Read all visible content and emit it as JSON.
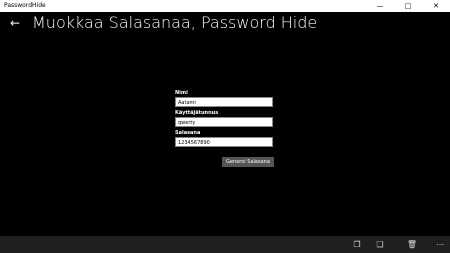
{
  "window": {
    "app_name": "PasswordHide",
    "minimize_icon": "minimize-icon",
    "maximize_icon": "maximize-icon",
    "close_icon": "close-icon"
  },
  "header": {
    "back_icon": "back-arrow-icon",
    "title": "Muokkaa Salasanaa, Password Hide"
  },
  "form": {
    "name_label": "Nimi",
    "name_value": "Aatami",
    "username_label": "Käyttäjätunnus",
    "username_value": "qwerty",
    "password_label": "Salasana",
    "password_value": "1234567890",
    "generate_button": "Generoi Salasana"
  },
  "appbar": {
    "icons": [
      "copy-icon",
      "paste-icon",
      "delete-icon",
      "more-icon"
    ]
  },
  "colors": {
    "background": "#000000",
    "titlebar": "#ffffff",
    "appbar": "#1f1f1f",
    "button": "#555555"
  }
}
